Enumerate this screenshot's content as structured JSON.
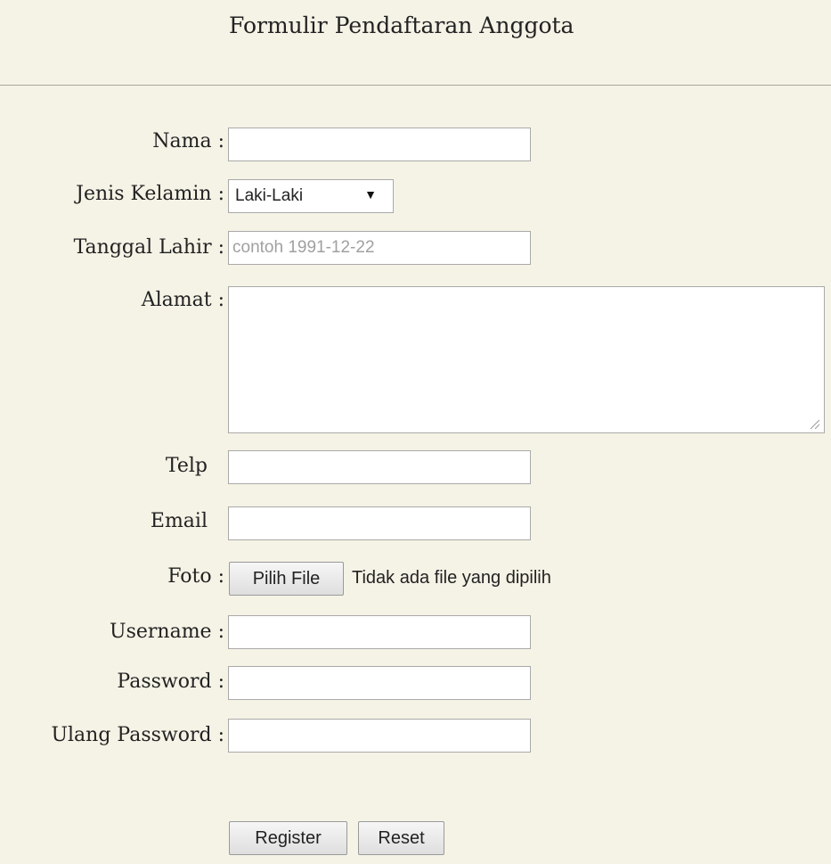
{
  "form": {
    "title": "Formulir Pendaftaran Anggota",
    "labels": {
      "nama": "Nama :",
      "jenis_kelamin": "Jenis Kelamin :",
      "tanggal_lahir": "Tanggal Lahir :",
      "alamat": "Alamat :",
      "telp": "Telp",
      "email": "Email",
      "foto": "Foto :",
      "username": "Username :",
      "password": "Password :",
      "ulang_password": "Ulang Password :"
    },
    "fields": {
      "nama_value": "",
      "jenis_kelamin_selected": "Laki-Laki",
      "tanggal_lahir_placeholder": "contoh 1991-12-22",
      "telp_value": "",
      "email_value": "",
      "username_value": "",
      "password_value": "",
      "ulang_password_value": ""
    },
    "file": {
      "button_label": "Pilih File",
      "status_text": "Tidak ada file yang dipilih"
    },
    "buttons": {
      "register": "Register",
      "reset": "Reset"
    }
  },
  "icons": {
    "select_arrow": "dropdown-arrow-icon",
    "textarea_grip": "resize-grip-icon"
  },
  "colors": {
    "background": "#f5f3e6",
    "divider": "#a8a89a",
    "input_border": "#a9a9a9",
    "placeholder": "#a0a0a0"
  }
}
